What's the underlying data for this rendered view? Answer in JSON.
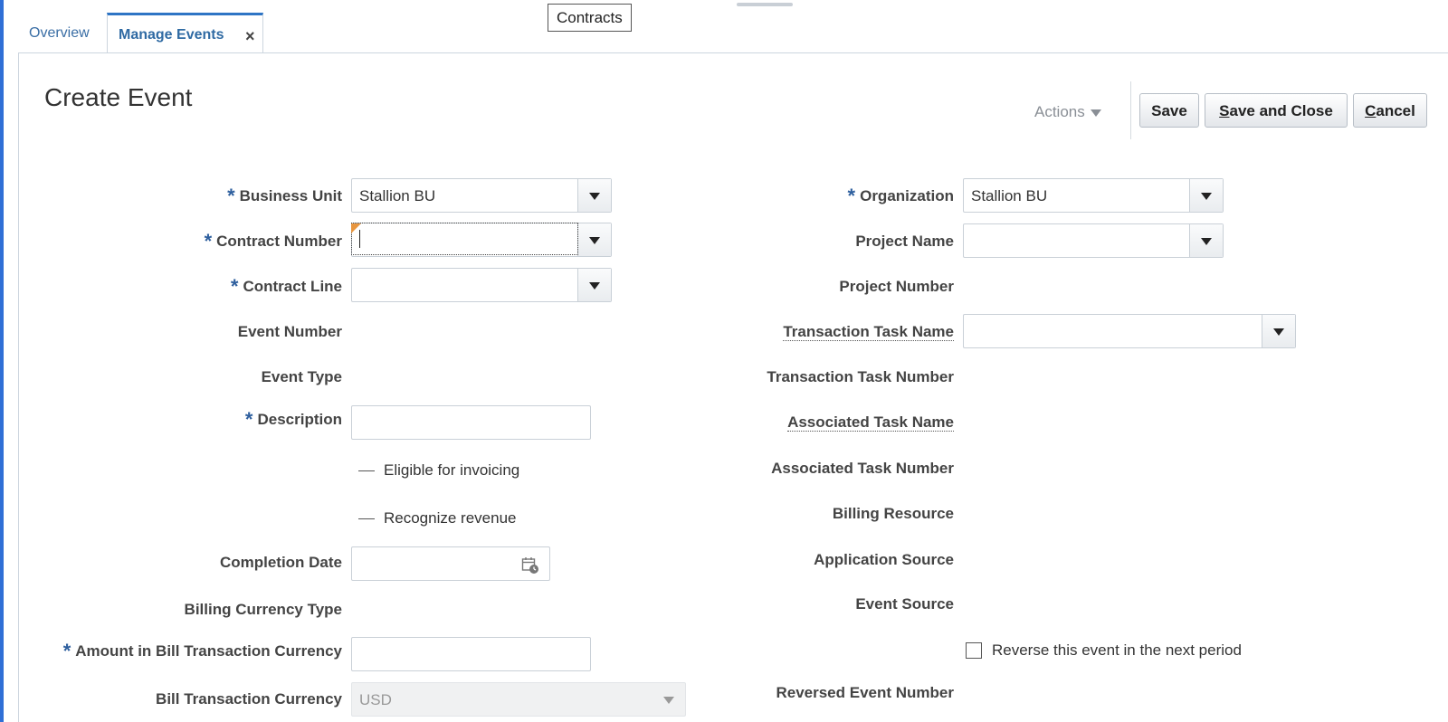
{
  "tabs": [
    {
      "label": "Overview"
    },
    {
      "label": "Manage Events"
    }
  ],
  "tooltip": "Contracts",
  "page": {
    "title": "Create Event",
    "actions_label": "Actions",
    "buttons": {
      "save": "Save",
      "save_and_close": "Save and Close",
      "cancel": "Cancel"
    }
  },
  "left": {
    "business_unit": {
      "label": "Business Unit",
      "value": "Stallion BU",
      "required": true
    },
    "contract_number": {
      "label": "Contract Number",
      "value": "",
      "required": true
    },
    "contract_line": {
      "label": "Contract Line",
      "value": "",
      "required": true
    },
    "event_number": {
      "label": "Event Number"
    },
    "event_type": {
      "label": "Event Type"
    },
    "description": {
      "label": "Description",
      "value": "",
      "required": true
    },
    "eligible_for_invoicing": {
      "label": "Eligible for invoicing"
    },
    "recognize_revenue": {
      "label": "Recognize revenue"
    },
    "completion_date": {
      "label": "Completion Date",
      "value": ""
    },
    "billing_currency_type": {
      "label": "Billing Currency Type"
    },
    "amount_bill_txn_currency": {
      "label": "Amount in Bill Transaction Currency",
      "value": "",
      "required": true
    },
    "bill_transaction_currency": {
      "label": "Bill Transaction Currency",
      "value": "USD"
    }
  },
  "right": {
    "organization": {
      "label": "Organization",
      "value": "Stallion BU",
      "required": true
    },
    "project_name": {
      "label": "Project Name",
      "value": ""
    },
    "project_number": {
      "label": "Project Number"
    },
    "transaction_task_name": {
      "label": "Transaction Task Name",
      "value": ""
    },
    "transaction_task_number": {
      "label": "Transaction Task Number"
    },
    "associated_task_name": {
      "label": "Associated Task Name"
    },
    "associated_task_number": {
      "label": "Associated Task Number"
    },
    "billing_resource": {
      "label": "Billing Resource"
    },
    "application_source": {
      "label": "Application Source"
    },
    "event_source": {
      "label": "Event Source"
    },
    "reverse_event": {
      "label": "Reverse this event in the next period",
      "checked": false
    },
    "reversed_event_number": {
      "label": "Reversed Event Number"
    }
  },
  "colors": {
    "accent": "#2e75c5",
    "required_star": "#2e5f9e",
    "tab_text": "#3a6ea5"
  },
  "icons": {
    "close": "close-icon",
    "calendar": "calendar-icon",
    "dropdown": "chevron-down-icon"
  }
}
